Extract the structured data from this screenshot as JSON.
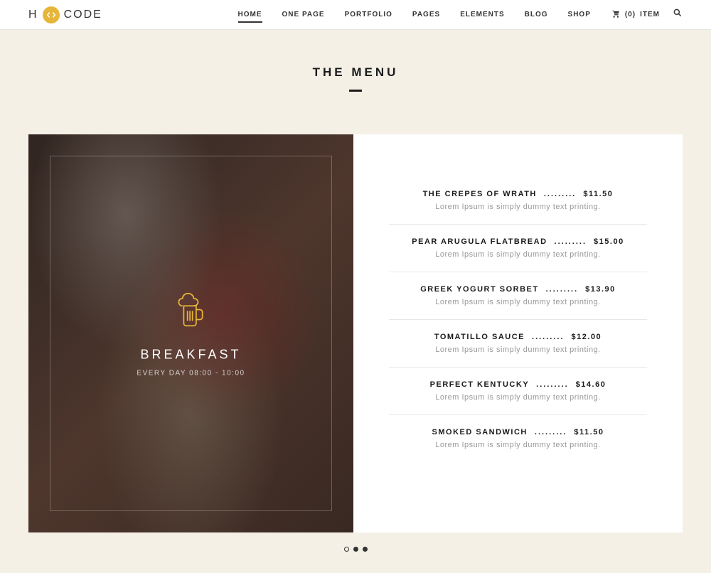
{
  "header": {
    "logo_h": "H",
    "logo_code": "CODE",
    "nav": [
      "HOME",
      "ONE PAGE",
      "PORTFOLIO",
      "PAGES",
      "ELEMENTS",
      "BLOG",
      "SHOP"
    ],
    "cart_count": "(0)",
    "cart_label": "ITEM"
  },
  "section": {
    "title": "THE MENU"
  },
  "feature": {
    "title": "BREAKFAST",
    "subtitle": "EVERY DAY 08:00 - 10:00"
  },
  "menu": [
    {
      "name": "THE CREPES OF WRATH",
      "price": "$11.50",
      "desc": "Lorem Ipsum is simply dummy text printing."
    },
    {
      "name": "PEAR ARUGULA FLATBREAD",
      "price": "$15.00",
      "desc": "Lorem Ipsum is simply dummy text printing."
    },
    {
      "name": "GREEK YOGURT SORBET",
      "price": "$13.90",
      "desc": "Lorem Ipsum is simply dummy text printing."
    },
    {
      "name": "TOMATILLO SAUCE",
      "price": "$12.00",
      "desc": "Lorem Ipsum is simply dummy text printing."
    },
    {
      "name": "PERFECT KENTUCKY",
      "price": "$14.60",
      "desc": "Lorem Ipsum is simply dummy text printing."
    },
    {
      "name": "SMOKED SANDWICH",
      "price": "$11.50",
      "desc": "Lorem Ipsum is simply dummy text printing."
    }
  ],
  "dots_separator": ".........",
  "pagination": {
    "total": 3,
    "active": 0
  }
}
